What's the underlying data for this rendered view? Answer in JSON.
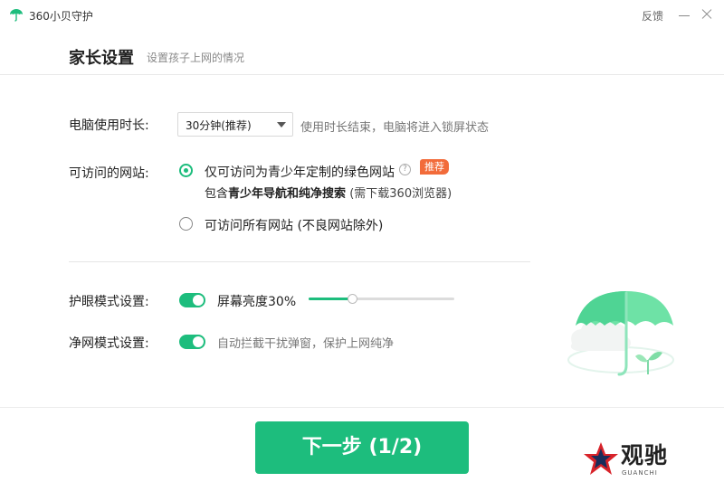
{
  "app": {
    "title": "360小贝守护"
  },
  "titlebar": {
    "feedback": "反馈"
  },
  "header": {
    "title": "家长设置",
    "subtitle": "设置孩子上网的情况"
  },
  "usage_time": {
    "label": "电脑使用时长:",
    "selected": "30分钟(推荐)",
    "hint": "使用时长结束，电脑将进入锁屏状态"
  },
  "websites": {
    "label": "可访问的网站:",
    "option_green": "仅可访问为青少年定制的绿色网站",
    "help": "?",
    "badge": "推荐",
    "desc_prefix": "包含",
    "desc_bold1": "青少年导航",
    "desc_and": "和",
    "desc_bold2": "纯净搜索",
    "desc_suffix": "(需下载360浏览器)",
    "option_all": "可访问所有网站 (不良网站除外)",
    "selected": "green"
  },
  "eye_mode": {
    "label": "护眼模式设置:",
    "enabled": true,
    "brightness_text": "屏幕亮度30%",
    "brightness": 0.3
  },
  "clean_mode": {
    "label": "净网模式设置:",
    "enabled": true,
    "hint": "自动拦截干扰弹窗，保护上网纯净"
  },
  "next_button": {
    "label": "下一步 (1/2)"
  },
  "watermark": {
    "text": "观驰",
    "sub": "GUANCHI"
  },
  "colors": {
    "accent": "#1dbd7d",
    "badge": "#f26b3a"
  }
}
